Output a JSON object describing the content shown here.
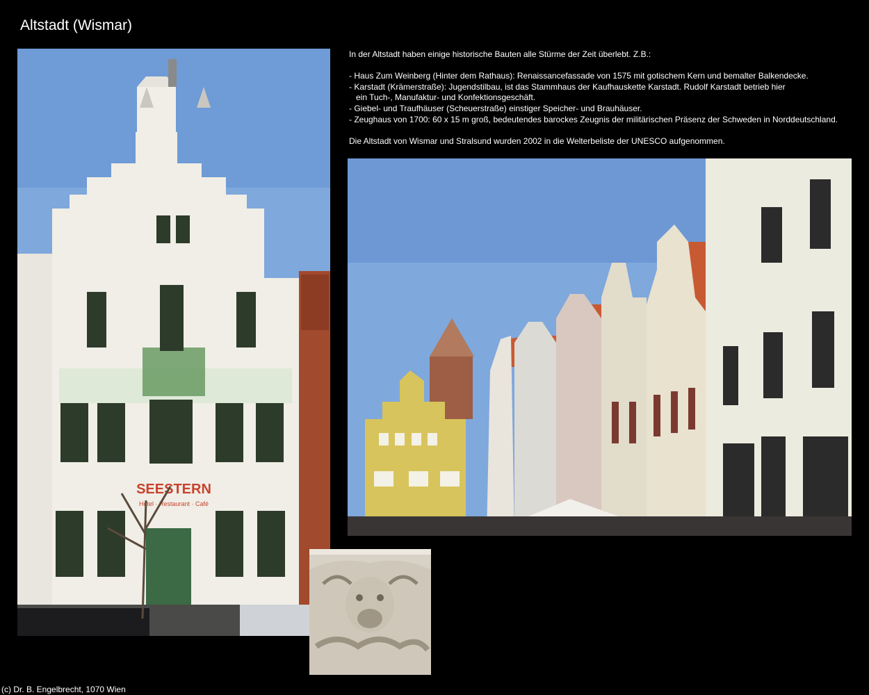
{
  "page": {
    "title": "Altstadt (Wismar)",
    "intro": "In der Altstadt haben einige historische Bauten alle Stürme der Zeit überlebt. Z.B.:",
    "items": [
      "- Haus Zum Weinberg (Hinter dem Rathaus): Renaissancefassade von 1575 mit gotischem Kern und bemalter Balkendecke.",
      "- Karstadt (Krämerstraße): Jugendstilbau, ist das Stammhaus der Kaufhauskette Karstadt. Rudolf Karstadt betrieb hier",
      "   ein Tuch-, Manufaktur- und Konfektionsgeschäft.",
      "- Giebel- und Traufhäuser (Scheuerstraße) einstiger Speicher- und Brauhäuser.",
      "- Zeughaus von 1700: 60 x 15 m groß, bedeutendes barockes Zeugnis der militärischen Präsenz der Schweden in Norddeutschland."
    ],
    "closing": "Die Altstadt von Wismar und Stralsund wurden 2002 in die Welterbeliste der UNESCO aufgenommen.",
    "footer": "(c) Dr. B. Engelbrecht, 1070 Wien"
  },
  "photos": {
    "main_sign": "SEESTERN",
    "main_subsign": "Hotel · Restaurant · Café"
  },
  "colors": {
    "background": "#000000",
    "text": "#ffffff",
    "sky": "#7fa8dc",
    "facade": "#f0eee6",
    "ornament": "#4e8a4a",
    "brick": "#a24a2e",
    "gable_yellow": "#d8c45c",
    "roof": "#c85a33"
  }
}
